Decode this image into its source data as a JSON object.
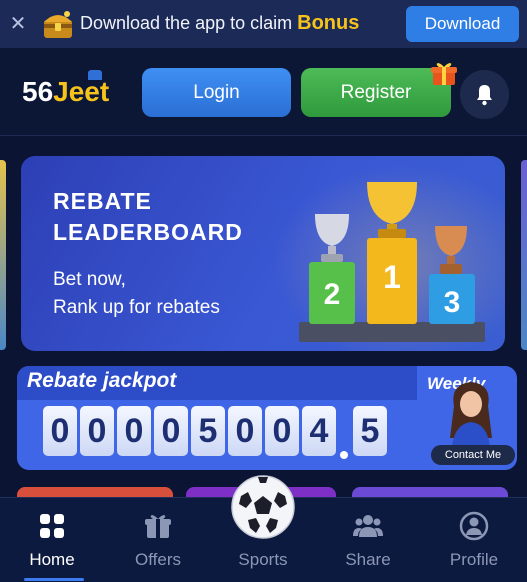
{
  "banner": {
    "message": "Download the app to claim",
    "bonus": "Bonus",
    "download_label": "Download",
    "close_glyph": "✕"
  },
  "header": {
    "logo_number": "56",
    "logo_word": "Jeet",
    "login_label": "Login",
    "register_label": "Register"
  },
  "hero": {
    "title_line1": "REBATE",
    "title_line2": "LEADERBOARD",
    "sub_line1": "Bet now,",
    "sub_line2": "Rank up for rebates",
    "ranks": [
      "2",
      "1",
      "3"
    ]
  },
  "jackpot": {
    "title": "Rebate jackpot",
    "period": "Weekly",
    "digits": [
      "0",
      "0",
      "0",
      "0",
      "5",
      "0",
      "0",
      "4",
      "5"
    ],
    "contact_label": "Contact Me"
  },
  "nav": {
    "items": [
      {
        "label": "Home",
        "icon": "grid-icon"
      },
      {
        "label": "Offers",
        "icon": "gift-icon"
      },
      {
        "label": "Sports",
        "icon": "soccer-ball-icon"
      },
      {
        "label": "Share",
        "icon": "users-icon"
      },
      {
        "label": "Profile",
        "icon": "user-circle-icon"
      }
    ]
  },
  "colors": {
    "background": "#0b1533",
    "accent_blue": "#2f7ee6",
    "accent_green": "#3fae49",
    "gold": "#f7c31b"
  }
}
